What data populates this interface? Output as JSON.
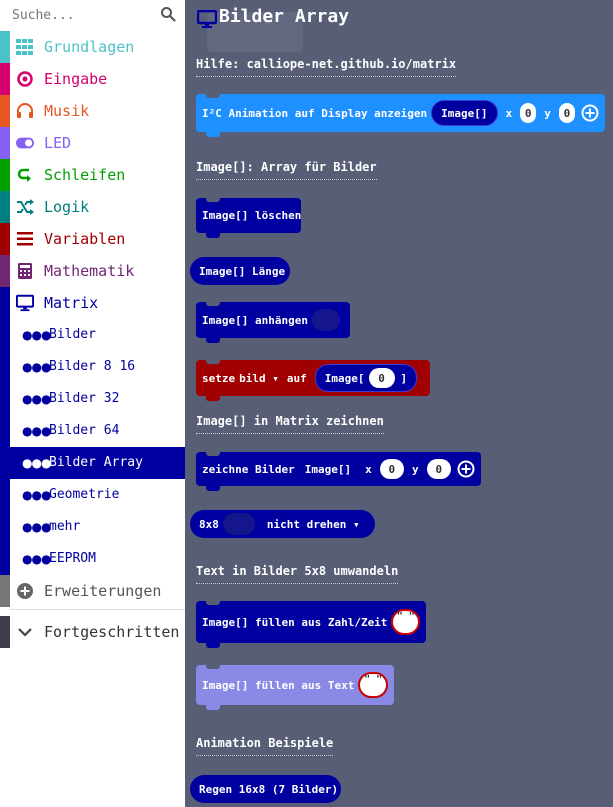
{
  "search": {
    "placeholder": "Suche..."
  },
  "categories": [
    {
      "label": "Grundlagen",
      "color": "#4cc2c8",
      "icon": "grid-icon"
    },
    {
      "label": "Eingabe",
      "color": "#d4006e",
      "icon": "target-icon"
    },
    {
      "label": "Musik",
      "color": "#e65722",
      "icon": "headphones-icon"
    },
    {
      "label": "LED",
      "color": "#8660f5",
      "icon": "toggle-icon"
    },
    {
      "label": "Schleifen",
      "color": "#00a000",
      "icon": "loop-icon"
    },
    {
      "label": "Logik",
      "color": "#007f7f",
      "icon": "shuffle-icon"
    },
    {
      "label": "Variablen",
      "color": "#a00000",
      "icon": "list-icon"
    },
    {
      "label": "Mathematik",
      "color": "#712672",
      "icon": "calculator-icon"
    },
    {
      "label": "Matrix",
      "color": "#0000a0",
      "icon": "monitor-icon"
    }
  ],
  "subcategories": [
    {
      "label": "Bilder"
    },
    {
      "label": "Bilder 8 16"
    },
    {
      "label": "Bilder 32"
    },
    {
      "label": "Bilder 64"
    },
    {
      "label": "Bilder Array",
      "selected": true
    },
    {
      "label": "Geometrie"
    },
    {
      "label": "mehr"
    },
    {
      "label": "EEPROM"
    }
  ],
  "extensions": {
    "label": "Erweiterungen",
    "icon": "plus-circle-icon"
  },
  "advanced": {
    "label": "Fortgeschritten",
    "icon": "chevron-down-icon"
  },
  "flyout": {
    "title": "Bilder Array",
    "help_label": "Hilfe: calliope-net.github.io/matrix",
    "b1": {
      "text": "I²C Animation auf Display anzeigen",
      "pill": "Image[]",
      "x": "x",
      "x_val": "0",
      "y": "y",
      "y_val": "0"
    },
    "section1": "Image[]: Array für Bilder",
    "b2": {
      "text": "Image[] löschen"
    },
    "b3": {
      "text": "Image[] Länge"
    },
    "b4": {
      "text": "Image[] anhängen"
    },
    "b5": {
      "setze": "setze",
      "var": "bild",
      "auf": "auf",
      "image": "Image[",
      "val": "0",
      "close": "]"
    },
    "section2": "Image[] in Matrix zeichnen",
    "b6": {
      "text": "zeichne Bilder",
      "pill": "Image[]",
      "x": "x",
      "x_val": "0",
      "y": "y",
      "y_val": "0"
    },
    "b7": {
      "size": "8x8",
      "mode": "nicht drehen"
    },
    "section3": "Text in Bilder 5x8 umwandeln",
    "b8": {
      "text": "Image[] füllen aus Zahl/Zeit",
      "str": "\" \""
    },
    "b9": {
      "text": "Image[] füllen aus Text",
      "str": "\" \""
    },
    "section4": "Animation Beispiele",
    "b10": {
      "text": "Regen 16x8 (7 Bilder)"
    }
  },
  "colors": {
    "flyout_bg": "#575e75",
    "matrix_dark": "#0000a0",
    "i2c_blue": "#1e90ff",
    "variable_red": "#a00000",
    "text_lavender": "#8a8ae6"
  }
}
